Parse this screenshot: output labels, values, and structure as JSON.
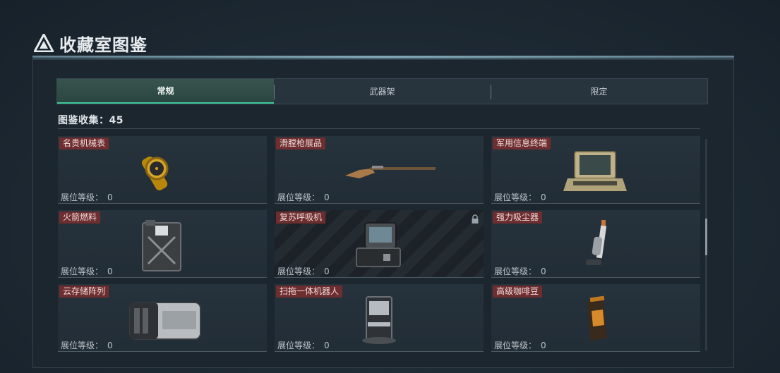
{
  "header": {
    "title": "收藏室图鉴",
    "logo_icon": "triangle-logo-icon"
  },
  "tabs": [
    {
      "label": "常规",
      "active": true
    },
    {
      "label": "武器架",
      "active": false
    },
    {
      "label": "限定",
      "active": false
    }
  ],
  "collection": {
    "label": "图鉴收集：45"
  },
  "level_label": "展位等级：",
  "items": [
    {
      "name": "名贵机械表",
      "level": "0",
      "icon": "gold-watch-icon",
      "locked": false
    },
    {
      "name": "滑膛枪展品",
      "level": "0",
      "icon": "musket-icon",
      "locked": false
    },
    {
      "name": "军用信息终端",
      "level": "0",
      "icon": "military-terminal-icon",
      "locked": false
    },
    {
      "name": "火箭燃料",
      "level": "0",
      "icon": "fuel-can-icon",
      "locked": false
    },
    {
      "name": "复苏呼吸机",
      "level": "0",
      "icon": "ventilator-icon",
      "locked": true
    },
    {
      "name": "强力吸尘器",
      "level": "0",
      "icon": "vacuum-cleaner-icon",
      "locked": false
    },
    {
      "name": "云存储阵列",
      "level": "0",
      "icon": "storage-array-icon",
      "locked": false
    },
    {
      "name": "扫拖一体机器人",
      "level": "0",
      "icon": "robot-vacuum-station-icon",
      "locked": false
    },
    {
      "name": "高级咖啡豆",
      "level": "0",
      "icon": "coffee-bag-icon",
      "locked": false
    }
  ],
  "colors": {
    "accent": "#3fc79a",
    "name_badge": "#6e2e30"
  }
}
